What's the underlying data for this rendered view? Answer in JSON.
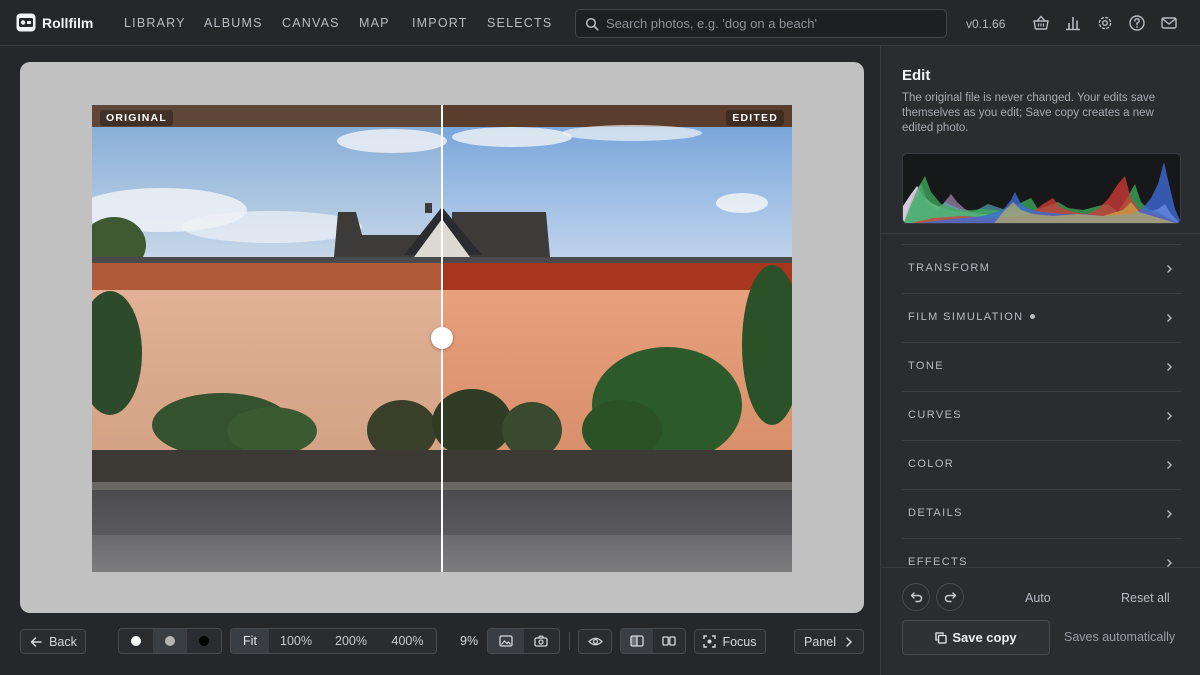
{
  "app": {
    "brand": "Rollfilm",
    "version": "v0.1.66"
  },
  "nav": {
    "items": [
      {
        "label": "LIBRARY"
      },
      {
        "label": "ALBUMS"
      },
      {
        "label": "CANVAS"
      },
      {
        "label": "MAP"
      },
      {
        "label": "IMPORT"
      },
      {
        "label": "SELECTS"
      }
    ]
  },
  "search": {
    "placeholder": "Search photos, e.g. 'dog on a beach'",
    "value": ""
  },
  "header_icons": [
    "basket-icon",
    "stats-icon",
    "settings-icon",
    "help-icon",
    "mail-icon"
  ],
  "viewer": {
    "original_label": "ORIGINAL",
    "edited_label": "EDITED",
    "split_position": 0.5
  },
  "toolbar": {
    "back_label": "Back",
    "background_options": [
      "white",
      "gray",
      "black"
    ],
    "zoom_options": [
      "Fit",
      "100%",
      "200%",
      "400%"
    ],
    "zoom_active": "Fit",
    "zoom_value": "9%",
    "focus_label": "Focus",
    "panel_label": "Panel"
  },
  "panel": {
    "title": "Edit",
    "description": "The original file is never changed. Your edits save themselves as you edit; Save copy creates a new edited photo.",
    "sections": [
      {
        "label": "TRANSFORM",
        "modified": false
      },
      {
        "label": "FILM SIMULATION",
        "modified": true
      },
      {
        "label": "TONE",
        "modified": false
      },
      {
        "label": "CURVES",
        "modified": false
      },
      {
        "label": "COLOR",
        "modified": false
      },
      {
        "label": "DETAILS",
        "modified": false
      },
      {
        "label": "EFFECTS",
        "modified": false
      }
    ],
    "auto_label": "Auto",
    "reset_label": "Reset all",
    "save_label": "Save copy",
    "autosave_text": "Saves automatically"
  },
  "colors": {
    "background": "#25272b",
    "panel": "#2a2c30",
    "viewer_bg": "#c1c1c1"
  }
}
